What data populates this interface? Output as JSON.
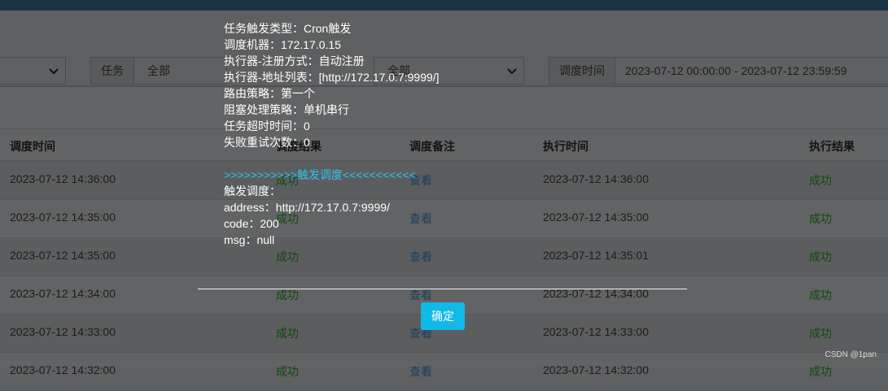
{
  "filters": {
    "job_label": "任务",
    "job_value": "全部",
    "status_value": "全部",
    "time_label": "调度时间",
    "time_value": "2023-07-12 00:00:00 - 2023-07-12 23:59:59"
  },
  "table": {
    "headers": [
      "调度时间",
      "调度结果",
      "调度备注",
      "执行时间",
      "执行结果"
    ],
    "rows": [
      {
        "trigger_time": "2023-07-12 14:36:00",
        "trigger_result": "成功",
        "remark": "查看",
        "handle_time": "2023-07-12 14:36:00",
        "handle_result": "成功"
      },
      {
        "trigger_time": "2023-07-12 14:35:00",
        "trigger_result": "成功",
        "remark": "查看",
        "handle_time": "2023-07-12 14:35:00",
        "handle_result": "成功"
      },
      {
        "trigger_time": "2023-07-12 14:35:00",
        "trigger_result": "成功",
        "remark": "查看",
        "handle_time": "2023-07-12 14:35:01",
        "handle_result": "成功"
      },
      {
        "trigger_time": "2023-07-12 14:34:00",
        "trigger_result": "成功",
        "remark": "查看",
        "handle_time": "2023-07-12 14:34:00",
        "handle_result": "成功"
      },
      {
        "trigger_time": "2023-07-12 14:33:00",
        "trigger_result": "成功",
        "remark": "查看",
        "handle_time": "2023-07-12 14:33:00",
        "handle_result": "成功"
      },
      {
        "trigger_time": "2023-07-12 14:32:00",
        "trigger_result": "成功",
        "remark": "查看",
        "handle_time": "2023-07-12 14:32:00",
        "handle_result": "成功"
      }
    ]
  },
  "modal": {
    "lines": [
      "任务触发类型：Cron触发",
      "调度机器：172.17.0.15",
      "执行器-注册方式：自动注册",
      "执行器-地址列表：[http://172.17.0.7:9999/]",
      "路由策略：第一个",
      "阻塞处理策略：单机串行",
      "任务超时时间：0",
      "失败重试次数：0"
    ],
    "separator": ">>>>>>>>>>>触发调度<<<<<<<<<<<",
    "result_lines": [
      "触发调度：",
      "address：http://172.17.0.7:9999/",
      "code：200",
      "msg：null"
    ],
    "confirm_label": "确定"
  },
  "watermark": "CSDN @1pan",
  "colors": {
    "accent": "#12b9e6",
    "separator": "#2ec3ee",
    "success": "#0f4a0f"
  }
}
